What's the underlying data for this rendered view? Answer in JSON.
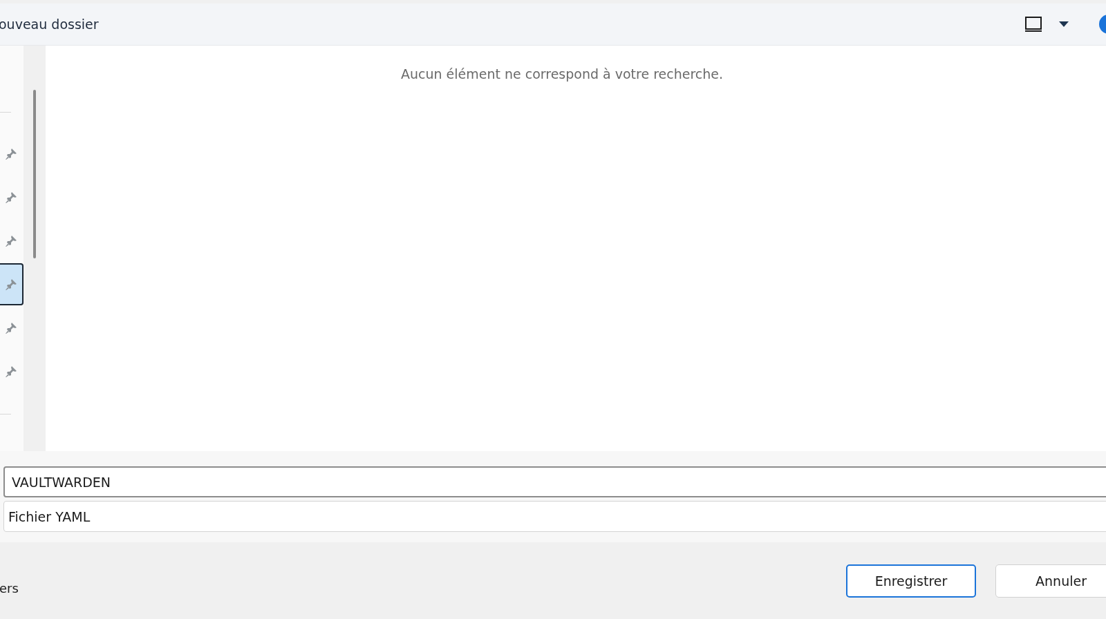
{
  "toolbar": {
    "new_folder": "ouveau dossier"
  },
  "sidebar": {
    "items": [
      {
        "pinned": true,
        "selected": false
      },
      {
        "pinned": true,
        "selected": false
      },
      {
        "pinned": true,
        "selected": false
      },
      {
        "pinned": true,
        "selected": true
      },
      {
        "pinned": true,
        "selected": false
      },
      {
        "pinned": true,
        "selected": false
      }
    ]
  },
  "content": {
    "message": "Aucun élément ne correspond à votre recherche."
  },
  "file_name": {
    "value": "VAULTWARDEN"
  },
  "file_type": {
    "value": "Fichier YAML"
  },
  "footer": {
    "toggle_folders": "ers"
  },
  "buttons": [
    {
      "label": "Enregistrer",
      "default": true
    },
    {
      "label": "Annuler",
      "default": false
    }
  ]
}
